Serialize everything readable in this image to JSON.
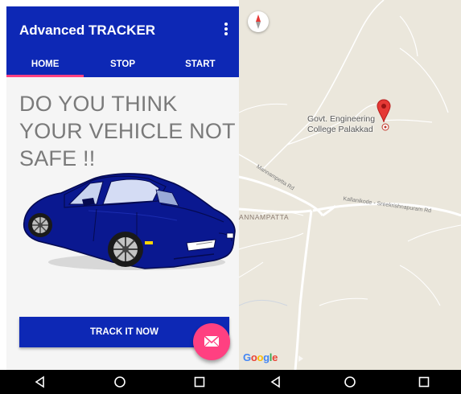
{
  "app": {
    "title": "Advanced TRACKER",
    "tabs": [
      {
        "label": "HOME",
        "active": true
      },
      {
        "label": "STOP",
        "active": false
      },
      {
        "label": "START",
        "active": false
      }
    ],
    "headline": "DO YOU THINK YOUR VEHICLE NOT SAFE !!",
    "track_button_label": "TRACK IT NOW",
    "fab_icon": "mail-icon"
  },
  "map": {
    "place_name_line1": "Govt. Engineering",
    "place_name_line2": "College Palakkad",
    "area_label": "ANNAMPATTA",
    "road_label_1": "Mannampetta Rd",
    "road_label_2": "Kallanikode - Sreekrishnapuram Rd",
    "logo_text": [
      "G",
      "o",
      "o",
      "g",
      "l",
      "e"
    ],
    "compass_icon": "compass-icon",
    "pin_icon": "map-pin-icon"
  },
  "navigation": {
    "buttons": [
      "back-icon",
      "home-icon",
      "recents-icon"
    ]
  },
  "colors": {
    "primary": "#0d28b5",
    "accent": "#ff4081",
    "map_background": "#ebe7dc",
    "headline_text": "#7a7a7a"
  }
}
